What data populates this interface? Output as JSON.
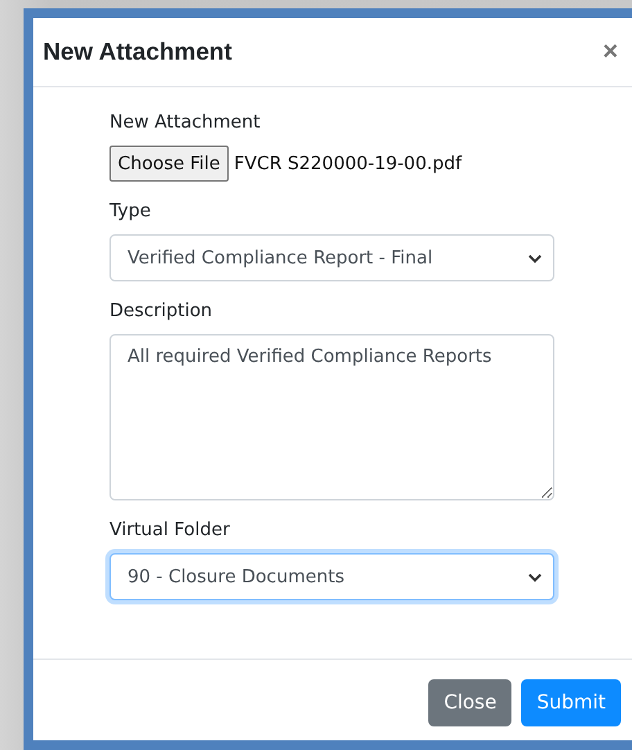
{
  "dialog": {
    "title": "New Attachment",
    "close_glyph": "×"
  },
  "fields": [
    {
      "kind": "file",
      "label": "New Attachment",
      "button": "Choose File",
      "value": "FVCR S220000-19-00.pdf"
    },
    {
      "kind": "select",
      "label": "Type",
      "value": "Verified Compliance Report - Final",
      "focused": false
    },
    {
      "kind": "textarea",
      "label": "Description",
      "value": "All required Verified Compliance Reports"
    },
    {
      "kind": "select",
      "label": "Virtual Folder",
      "value": "90 - Closure Documents",
      "focused": true
    }
  ],
  "buttons": [
    {
      "label": "Close",
      "kind": "secondary"
    },
    {
      "label": "Submit",
      "kind": "primary"
    }
  ]
}
